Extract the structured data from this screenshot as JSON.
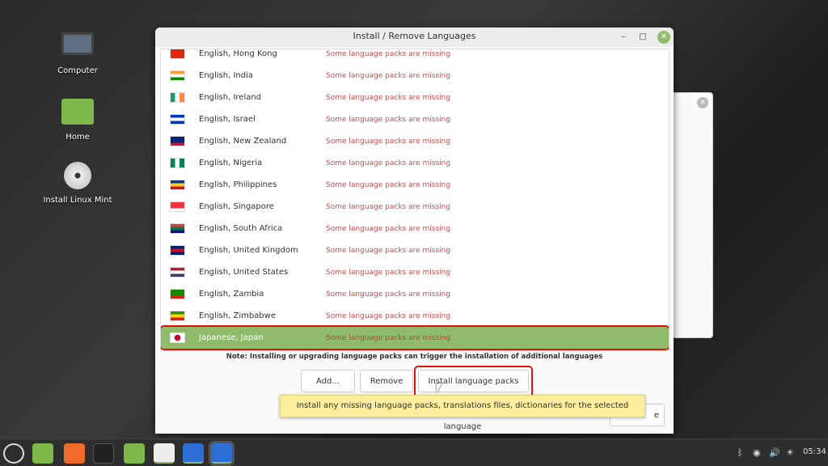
{
  "desktop": {
    "icons": [
      {
        "label": "Computer",
        "icon": "computer-icon"
      },
      {
        "label": "Home",
        "icon": "folder-icon"
      },
      {
        "label": "Install Linux Mint",
        "icon": "disc-icon"
      }
    ]
  },
  "window": {
    "title": "Install / Remove Languages",
    "minimize": "–",
    "maximize": "□",
    "close": "✕"
  },
  "languages": [
    {
      "name": "English, Hong Kong",
      "status": "Some language packs are missing",
      "flag": [
        "#de2910",
        "#de2910",
        "#de2910"
      ]
    },
    {
      "name": "English, India",
      "status": "Some language packs are missing",
      "flag": [
        "#ff9933",
        "#ffffff",
        "#138808"
      ]
    },
    {
      "name": "English, Ireland",
      "status": "Some language packs are missing",
      "flag": [
        "#169b62",
        "#ffffff",
        "#ff883e"
      ],
      "vertical": true
    },
    {
      "name": "English, Israel",
      "status": "Some language packs are missing",
      "flag": [
        "#0038b8",
        "#ffffff",
        "#0038b8"
      ]
    },
    {
      "name": "English, New Zealand",
      "status": "Some language packs are missing",
      "flag": [
        "#00247d",
        "#00247d",
        "#cc142b"
      ]
    },
    {
      "name": "English, Nigeria",
      "status": "Some language packs are missing",
      "flag": [
        "#008751",
        "#ffffff",
        "#008751"
      ],
      "vertical": true
    },
    {
      "name": "English, Philippines",
      "status": "Some language packs are missing",
      "flag": [
        "#0038a8",
        "#fcd116",
        "#ce1126"
      ]
    },
    {
      "name": "English, Singapore",
      "status": "Some language packs are missing",
      "flag": [
        "#ef3340",
        "#ef3340",
        "#ffffff"
      ]
    },
    {
      "name": "English, South Africa",
      "status": "Some language packs are missing",
      "flag": [
        "#e03c31",
        "#007749",
        "#001489"
      ]
    },
    {
      "name": "English, United Kingdom",
      "status": "Some language packs are missing",
      "flag": [
        "#012169",
        "#c8102e",
        "#012169"
      ]
    },
    {
      "name": "English, United States",
      "status": "Some language packs are missing",
      "flag": [
        "#b22234",
        "#ffffff",
        "#3c3b6e"
      ]
    },
    {
      "name": "English, Zambia",
      "status": "Some language packs are missing",
      "flag": [
        "#198a00",
        "#198a00",
        "#de2010"
      ]
    },
    {
      "name": "English, Zimbabwe",
      "status": "Some language packs are missing",
      "flag": [
        "#319208",
        "#ffd200",
        "#de2010"
      ]
    },
    {
      "name": "Japanese, Japan",
      "status": "Some language packs are missing",
      "flag": [
        "#ffffff",
        "#ffffff",
        "#ffffff"
      ],
      "selected": true
    }
  ],
  "note": "Note: Installing or upgrading language packs can trigger the installation of additional languages",
  "buttons": {
    "add": "Add...",
    "remove": "Remove",
    "install": "Install language packs",
    "close_partial": "e"
  },
  "tooltip": "Install any missing language packs, translations files, dictionaries for the selected language",
  "taskbar": {
    "clock": "05:34",
    "accent": "#8fbb6a"
  }
}
